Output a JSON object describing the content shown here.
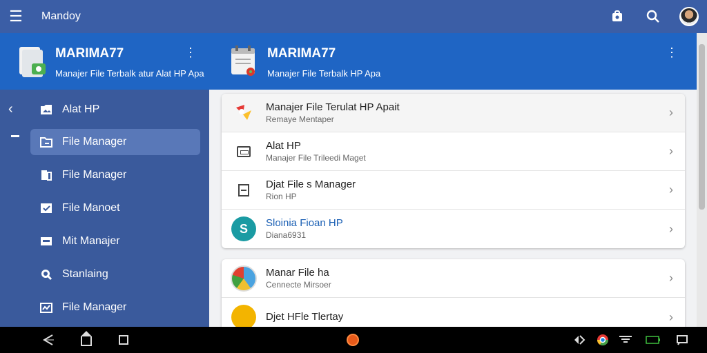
{
  "appbar": {
    "title": "Mandoy",
    "icons": [
      "menu-icon",
      "store-icon",
      "search-icon",
      "avatar"
    ]
  },
  "left_header": {
    "name": "MARIMA77",
    "subtitle": "Manajer File Terbalk atur Alat HP Apa"
  },
  "right_header": {
    "name": "MARIMA77",
    "subtitle": "Manajer File Terbalk HP Apa"
  },
  "sidebar": {
    "items": [
      {
        "label": "Alat HP",
        "icon": "gallery-icon",
        "active": false
      },
      {
        "label": "File Manager",
        "icon": "folder-icon",
        "active": true
      },
      {
        "label": "File Manager",
        "icon": "file-icon",
        "active": false
      },
      {
        "label": "File Manoet",
        "icon": "check-icon",
        "active": false
      },
      {
        "label": "Mit Manajer",
        "icon": "card-icon",
        "active": false
      },
      {
        "label": "Stanlaing",
        "icon": "search-icon",
        "active": false
      },
      {
        "label": "File Manager",
        "icon": "chart-icon",
        "active": false
      }
    ]
  },
  "cards": [
    {
      "rows": [
        {
          "title": "Manajer File Terulat HP Apait",
          "subtitle": "Remaye Mentaper",
          "icon": "photos-icon",
          "highlight": true
        },
        {
          "title": "Alat HP",
          "subtitle": "Manajer File Trileedi Maget",
          "icon": "window-icon"
        },
        {
          "title": "Djat File s Manager",
          "subtitle": "Rion HP",
          "icon": "box-icon"
        },
        {
          "title": "Sloinia Fioan HP",
          "subtitle": "Diana6931",
          "icon": "teal-app-icon",
          "blue": true
        }
      ]
    },
    {
      "rows": [
        {
          "title": "Manar File ha",
          "subtitle": "Cennecte Mirsoer",
          "icon": "globe-icon"
        },
        {
          "title": "Djet HFle Tlertay",
          "subtitle": "",
          "icon": "yellow-app-icon"
        }
      ]
    }
  ],
  "colors": {
    "appbar": "#3b5ea6",
    "header": "#1f65c4",
    "sidebar": "#3a5a9c",
    "active_item": "#5978b8",
    "main_bg": "#f1f2f4",
    "link": "#1a5fb4"
  }
}
